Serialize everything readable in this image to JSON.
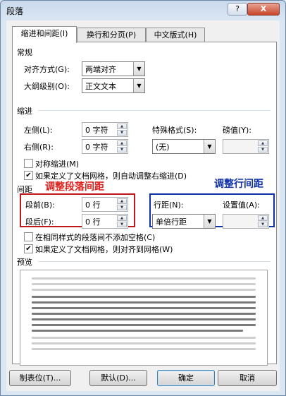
{
  "window": {
    "title": "段落",
    "help_label": "?",
    "close_label": "X"
  },
  "tabs": [
    {
      "label": "缩进和间距(I)"
    },
    {
      "label": "换行和分页(P)"
    },
    {
      "label": "中文版式(H)"
    }
  ],
  "general": {
    "section": "常规",
    "alignment_label": "对齐方式(G):",
    "alignment_value": "两端对齐",
    "outline_label": "大纲级别(O):",
    "outline_value": "正文文本"
  },
  "indent": {
    "section": "缩进",
    "left_label": "左侧(L):",
    "left_value": "0 字符",
    "right_label": "右侧(R):",
    "right_value": "0 字符",
    "special_label": "特殊格式(S):",
    "special_value": "(无)",
    "by_label": "磅值(Y):",
    "mirror_label": "对称缩进(M)",
    "mirror_checked": false,
    "auto_right_label": "如果定义了文档网格，则自动调整右缩进(D)",
    "auto_right_checked": true
  },
  "spacing": {
    "section": "间距",
    "before_label": "段前(B):",
    "before_value": "0 行",
    "after_label": "段后(F):",
    "after_value": "0 行",
    "line_label": "行距(N):",
    "line_value": "单倍行距",
    "at_label": "设置值(A):",
    "no_space_label": "在相同样式的段落间不添加空格(C)",
    "no_space_checked": false,
    "snap_grid_label": "如果定义了文档网格，则对齐到网格(W)",
    "snap_grid_checked": true
  },
  "annotations": {
    "red": "调整段落间距",
    "blue": "调整行间距"
  },
  "preview": {
    "section": "预览"
  },
  "buttons": {
    "tabs_label": "制表位(T)...",
    "default_label": "默认(D)...",
    "ok_label": "确定",
    "cancel_label": "取消"
  },
  "colors": {
    "annotation_red": "#c0161a",
    "annotation_blue": "#1030a8"
  }
}
